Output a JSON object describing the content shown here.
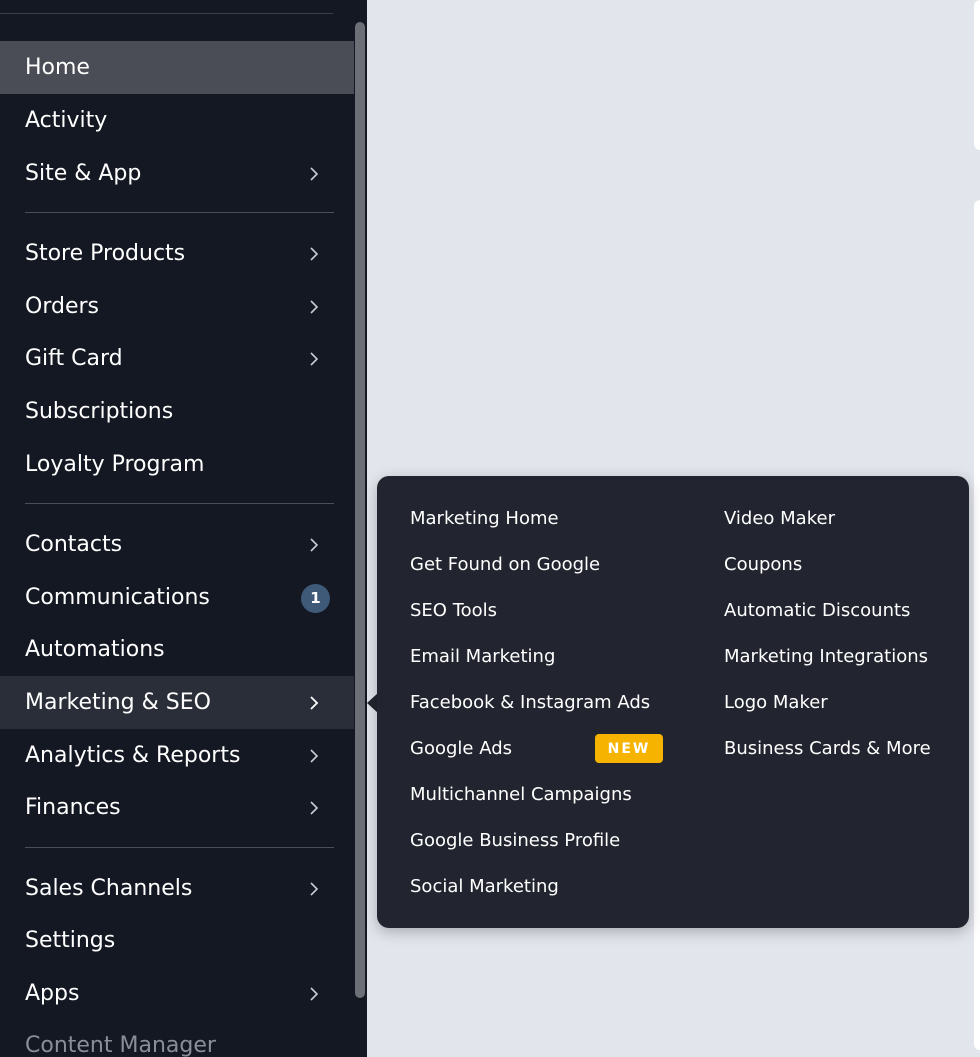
{
  "sidebar": {
    "items": [
      {
        "label": "Home",
        "chevron": false
      },
      {
        "label": "Activity",
        "chevron": false
      },
      {
        "label": "Site & App",
        "chevron": true
      },
      {
        "label": "Store Products",
        "chevron": true
      },
      {
        "label": "Orders",
        "chevron": true
      },
      {
        "label": "Gift Card",
        "chevron": true
      },
      {
        "label": "Subscriptions",
        "chevron": false
      },
      {
        "label": "Loyalty Program",
        "chevron": false
      },
      {
        "label": "Contacts",
        "chevron": true
      },
      {
        "label": "Communications",
        "badge": "1"
      },
      {
        "label": "Automations",
        "chevron": false
      },
      {
        "label": "Marketing & SEO",
        "chevron": true
      },
      {
        "label": "Analytics & Reports",
        "chevron": true
      },
      {
        "label": "Finances",
        "chevron": true
      },
      {
        "label": "Sales Channels",
        "chevron": true
      },
      {
        "label": "Settings",
        "chevron": false
      },
      {
        "label": "Apps",
        "chevron": true
      },
      {
        "label": "Content Manager",
        "chevron": false
      }
    ],
    "selected": "Home",
    "hovered": "Marketing & SEO"
  },
  "submenu": {
    "left_column": [
      "Marketing Home",
      "Get Found on Google",
      "SEO Tools",
      "Email Marketing",
      "Facebook & Instagram Ads",
      "Google Ads",
      "Multichannel Campaigns",
      "Google Business Profile",
      "Social Marketing"
    ],
    "right_column": [
      "Video Maker",
      "Coupons",
      "Automatic Discounts",
      "Marketing Integrations",
      "Logo Maker",
      "Business Cards & More"
    ],
    "new_badge": "NEW"
  },
  "colors": {
    "sidebar_bg": "#141823",
    "selected_bg": "#4a4d55",
    "hover_bg": "#2a2e38",
    "submenu_bg": "#22252f",
    "badge_bg": "#3f5a79",
    "new_badge_bg": "#f6b400",
    "content_bg": "#e2e5ec"
  }
}
